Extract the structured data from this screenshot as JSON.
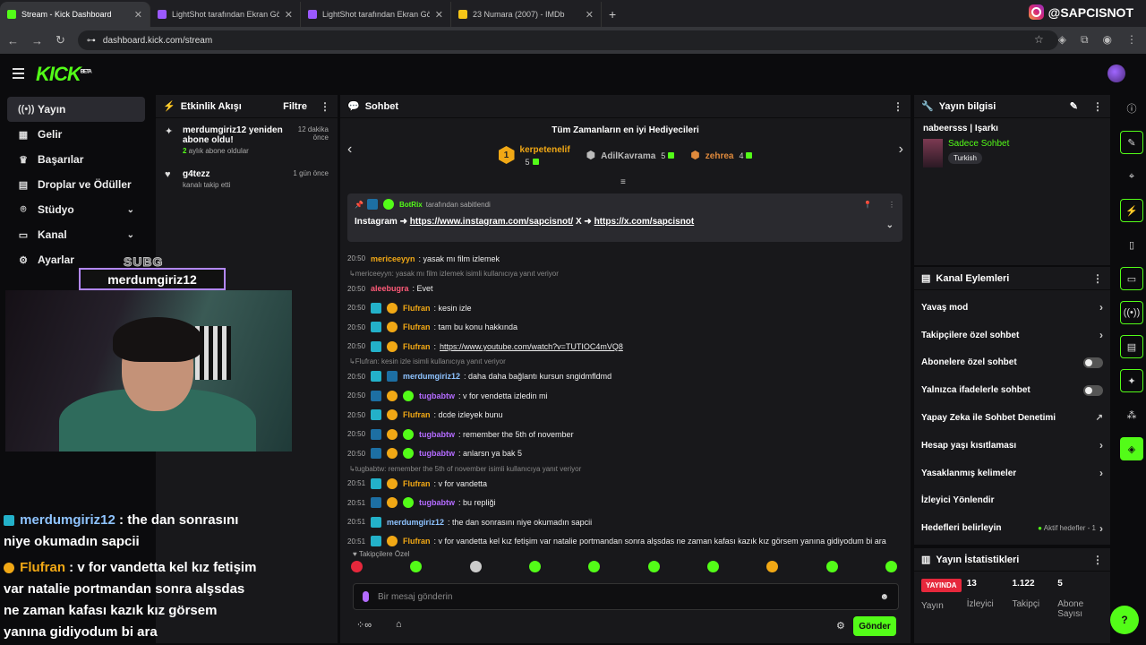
{
  "browser": {
    "tabs": [
      {
        "title": "Stream - Kick Dashboard",
        "color": "#53fc18",
        "active": true
      },
      {
        "title": "LightShot tarafından Ekran Gör",
        "color": "#9b59ff"
      },
      {
        "title": "LightShot tarafından Ekran Gör",
        "color": "#9b59ff"
      },
      {
        "title": "23 Numara (2007) - IMDb",
        "color": "#f5c518"
      }
    ],
    "url": "dashboard.kick.com/stream",
    "brand": "@SAPCISNOT"
  },
  "app": {
    "logo": "KICK",
    "logo_sup": "BETA"
  },
  "sidebar": {
    "items": [
      {
        "label": "Yayın",
        "icon": "broadcast-icon",
        "glyph": "((•))"
      },
      {
        "label": "Gelir",
        "icon": "revenue-icon",
        "glyph": "▦"
      },
      {
        "label": "Başarılar",
        "icon": "trophy-icon",
        "glyph": "♛"
      },
      {
        "label": "Droplar ve Ödüller",
        "icon": "drops-icon",
        "glyph": "▤"
      },
      {
        "label": "Stüdyo",
        "icon": "studio-icon",
        "glyph": "⌾"
      },
      {
        "label": "Kanal",
        "icon": "channel-icon",
        "glyph": "▭"
      },
      {
        "label": "Ayarlar",
        "icon": "settings-icon",
        "glyph": "⚙"
      }
    ]
  },
  "activity": {
    "title": "Etkinlik Akışı",
    "filter": "Filtre",
    "items": [
      {
        "name": "merdumgiriz12 yeniden abone oldu!",
        "highlight": "2",
        "sub": " aylık abone oldular",
        "time": "12 dakika önce"
      },
      {
        "name": "g4tezz",
        "highlight": "",
        "sub": "kanalı takip etti",
        "time": "1 gün önce"
      }
    ]
  },
  "chat": {
    "title": "Sohbet",
    "gifters_title": "Tüm Zamanların en iyi Hediyecileri",
    "gifters": [
      {
        "rank": "1",
        "name": "kerpetenelif",
        "count": "5",
        "color": "#f1a815"
      },
      {
        "name": "AdilKavrama",
        "count": "5",
        "color": "#bbbbbb"
      },
      {
        "name": "zehrea",
        "count": "4",
        "color": "#e08a3c"
      }
    ],
    "pinned_by": "BotRix",
    "pinned_suffix": "tarafından sabitlendi",
    "pinned_prefix": "Instagram ➜ ",
    "pinned_link1": "https://www.instagram.com/sapcisnot/",
    "pinned_mid": " X ➜ ",
    "pinned_link2": "https://x.com/sapcisnot",
    "messages": [
      {
        "time": "20:50",
        "user": "mericeeyyn",
        "color": "#f1a815",
        "text": ": yasak mı film izlemek",
        "badges": []
      },
      {
        "reply": "mericeeyyn: yasak mı film izlemek isimli kullanıcıya yanıt veriyor"
      },
      {
        "time": "20:50",
        "user": "aleebugra",
        "color": "#ff5a78",
        "text": ": Evet",
        "badges": []
      },
      {
        "time": "20:50",
        "user": "Flufran",
        "color": "#f1a815",
        "text": ": kesin izle",
        "badges": [
          "b-cyan",
          "b-gift"
        ]
      },
      {
        "time": "20:50",
        "user": "Flufran",
        "color": "#f1a815",
        "text": ": tam bu konu hakkında",
        "badges": [
          "b-cyan",
          "b-gift"
        ]
      },
      {
        "time": "20:50",
        "user": "Flufran",
        "color": "#f1a815",
        "text": ": ",
        "link": "https://www.youtube.com/watch?v=TUTIOC4mVQ8",
        "badges": [
          "b-cyan",
          "b-gift"
        ]
      },
      {
        "reply": "Flufran: kesin izle isimli kullanıcıya yanıt veriyor"
      },
      {
        "time": "20:50",
        "user": "merdumgiriz12",
        "color": "#8ec3ff",
        "text": ": daha daha bağlantı kursun sngidmfldmd",
        "badges": [
          "b-cyan",
          "b-sub"
        ]
      },
      {
        "time": "20:50",
        "user": "tugbabtw",
        "color": "#b46bff",
        "text": ": v for vendetta izledin mi",
        "badges": [
          "b-sub",
          "b-gift",
          "b-bot"
        ]
      },
      {
        "time": "20:50",
        "user": "Flufran",
        "color": "#f1a815",
        "text": ": dcde izleyek bunu",
        "badges": [
          "b-cyan",
          "b-gift"
        ]
      },
      {
        "time": "20:50",
        "user": "tugbabtw",
        "color": "#b46bff",
        "text": ": remember the 5th of november",
        "badges": [
          "b-sub",
          "b-gift",
          "b-bot"
        ]
      },
      {
        "time": "20:50",
        "user": "tugbabtw",
        "color": "#b46bff",
        "text": ": anlarsn ya bak 5",
        "badges": [
          "b-sub",
          "b-gift",
          "b-bot"
        ]
      },
      {
        "reply": "tugbabtw: remember the 5th of november isimli kullanıcıya yanıt veriyor"
      },
      {
        "time": "20:51",
        "user": "Flufran",
        "color": "#f1a815",
        "text": ": v for vandetta",
        "badges": [
          "b-cyan",
          "b-gift"
        ]
      },
      {
        "time": "20:51",
        "user": "tugbabtw",
        "color": "#b46bff",
        "text": ": bu repliği",
        "badges": [
          "b-sub",
          "b-gift",
          "b-bot"
        ]
      },
      {
        "time": "20:51",
        "user": "merdumgiriz12",
        "color": "#8ec3ff",
        "text": ": the dan sonrasını niye okumadın sapcii",
        "badges": [
          "b-cyan"
        ]
      },
      {
        "time": "20:51",
        "user": "Flufran",
        "color": "#f1a815",
        "text": ": v for vandetta kel kız fetişim var natalie portmandan sonra alşsdas ne zaman kafası kazık kız görsem yanına gidiyodum bi ara",
        "badges": [
          "b-cyan",
          "b-gift"
        ]
      }
    ],
    "followers_only": "Takipçilere Özel",
    "input_placeholder": "Bir mesaj gönderin",
    "send": "Gönder"
  },
  "stream_info": {
    "title": "Yayın bilgisi",
    "stream_title": "nabeersss | Işarkı",
    "category": "Sadece Sohbet",
    "language": "Turkish"
  },
  "channel_actions": {
    "title": "Kanal Eylemleri",
    "rows": [
      {
        "label": "Yavaş mod",
        "type": "chevron"
      },
      {
        "label": "Takipçilere özel sohbet",
        "type": "chevron"
      },
      {
        "label": "Abonelere özel sohbet",
        "type": "toggle"
      },
      {
        "label": "Yalnızca ifadelerle sohbet",
        "type": "toggle"
      },
      {
        "label": "Yapay Zeka ile Sohbet Denetimi",
        "type": "external"
      },
      {
        "label": "Hesap yaşı kısıtlaması",
        "type": "chevron"
      },
      {
        "label": "Yasaklanmış kelimeler",
        "type": "chevron"
      },
      {
        "label": "İzleyici Yönlendir",
        "type": "none"
      },
      {
        "label": "Hedefleri belirleyin",
        "type": "goal",
        "extra": "Aktif hedefler - 1"
      }
    ]
  },
  "stats": {
    "title": "Yayın İstatistikleri",
    "live": "YAYINDA",
    "items": [
      {
        "value": "",
        "label": "Yayın"
      },
      {
        "value": "13",
        "label": "İzleyici"
      },
      {
        "value": "1.122",
        "label": "Takipçi"
      },
      {
        "value": "5",
        "label": "Abone Sayısı"
      }
    ]
  },
  "overlay": {
    "sub_label": "SUBG",
    "sub_name": "merdumgiriz12",
    "line1_user": "merdumgiriz12",
    "line1_text": " : the dan sonrasını niye okumadın sapcii",
    "line2_user": "Flufran",
    "line2_text": " : v for vandetta kel kız fetişim var natalie portmandan sonra alşsdas ne zaman kafası kazık kız görsem yanına gidiyodum bi ara"
  }
}
